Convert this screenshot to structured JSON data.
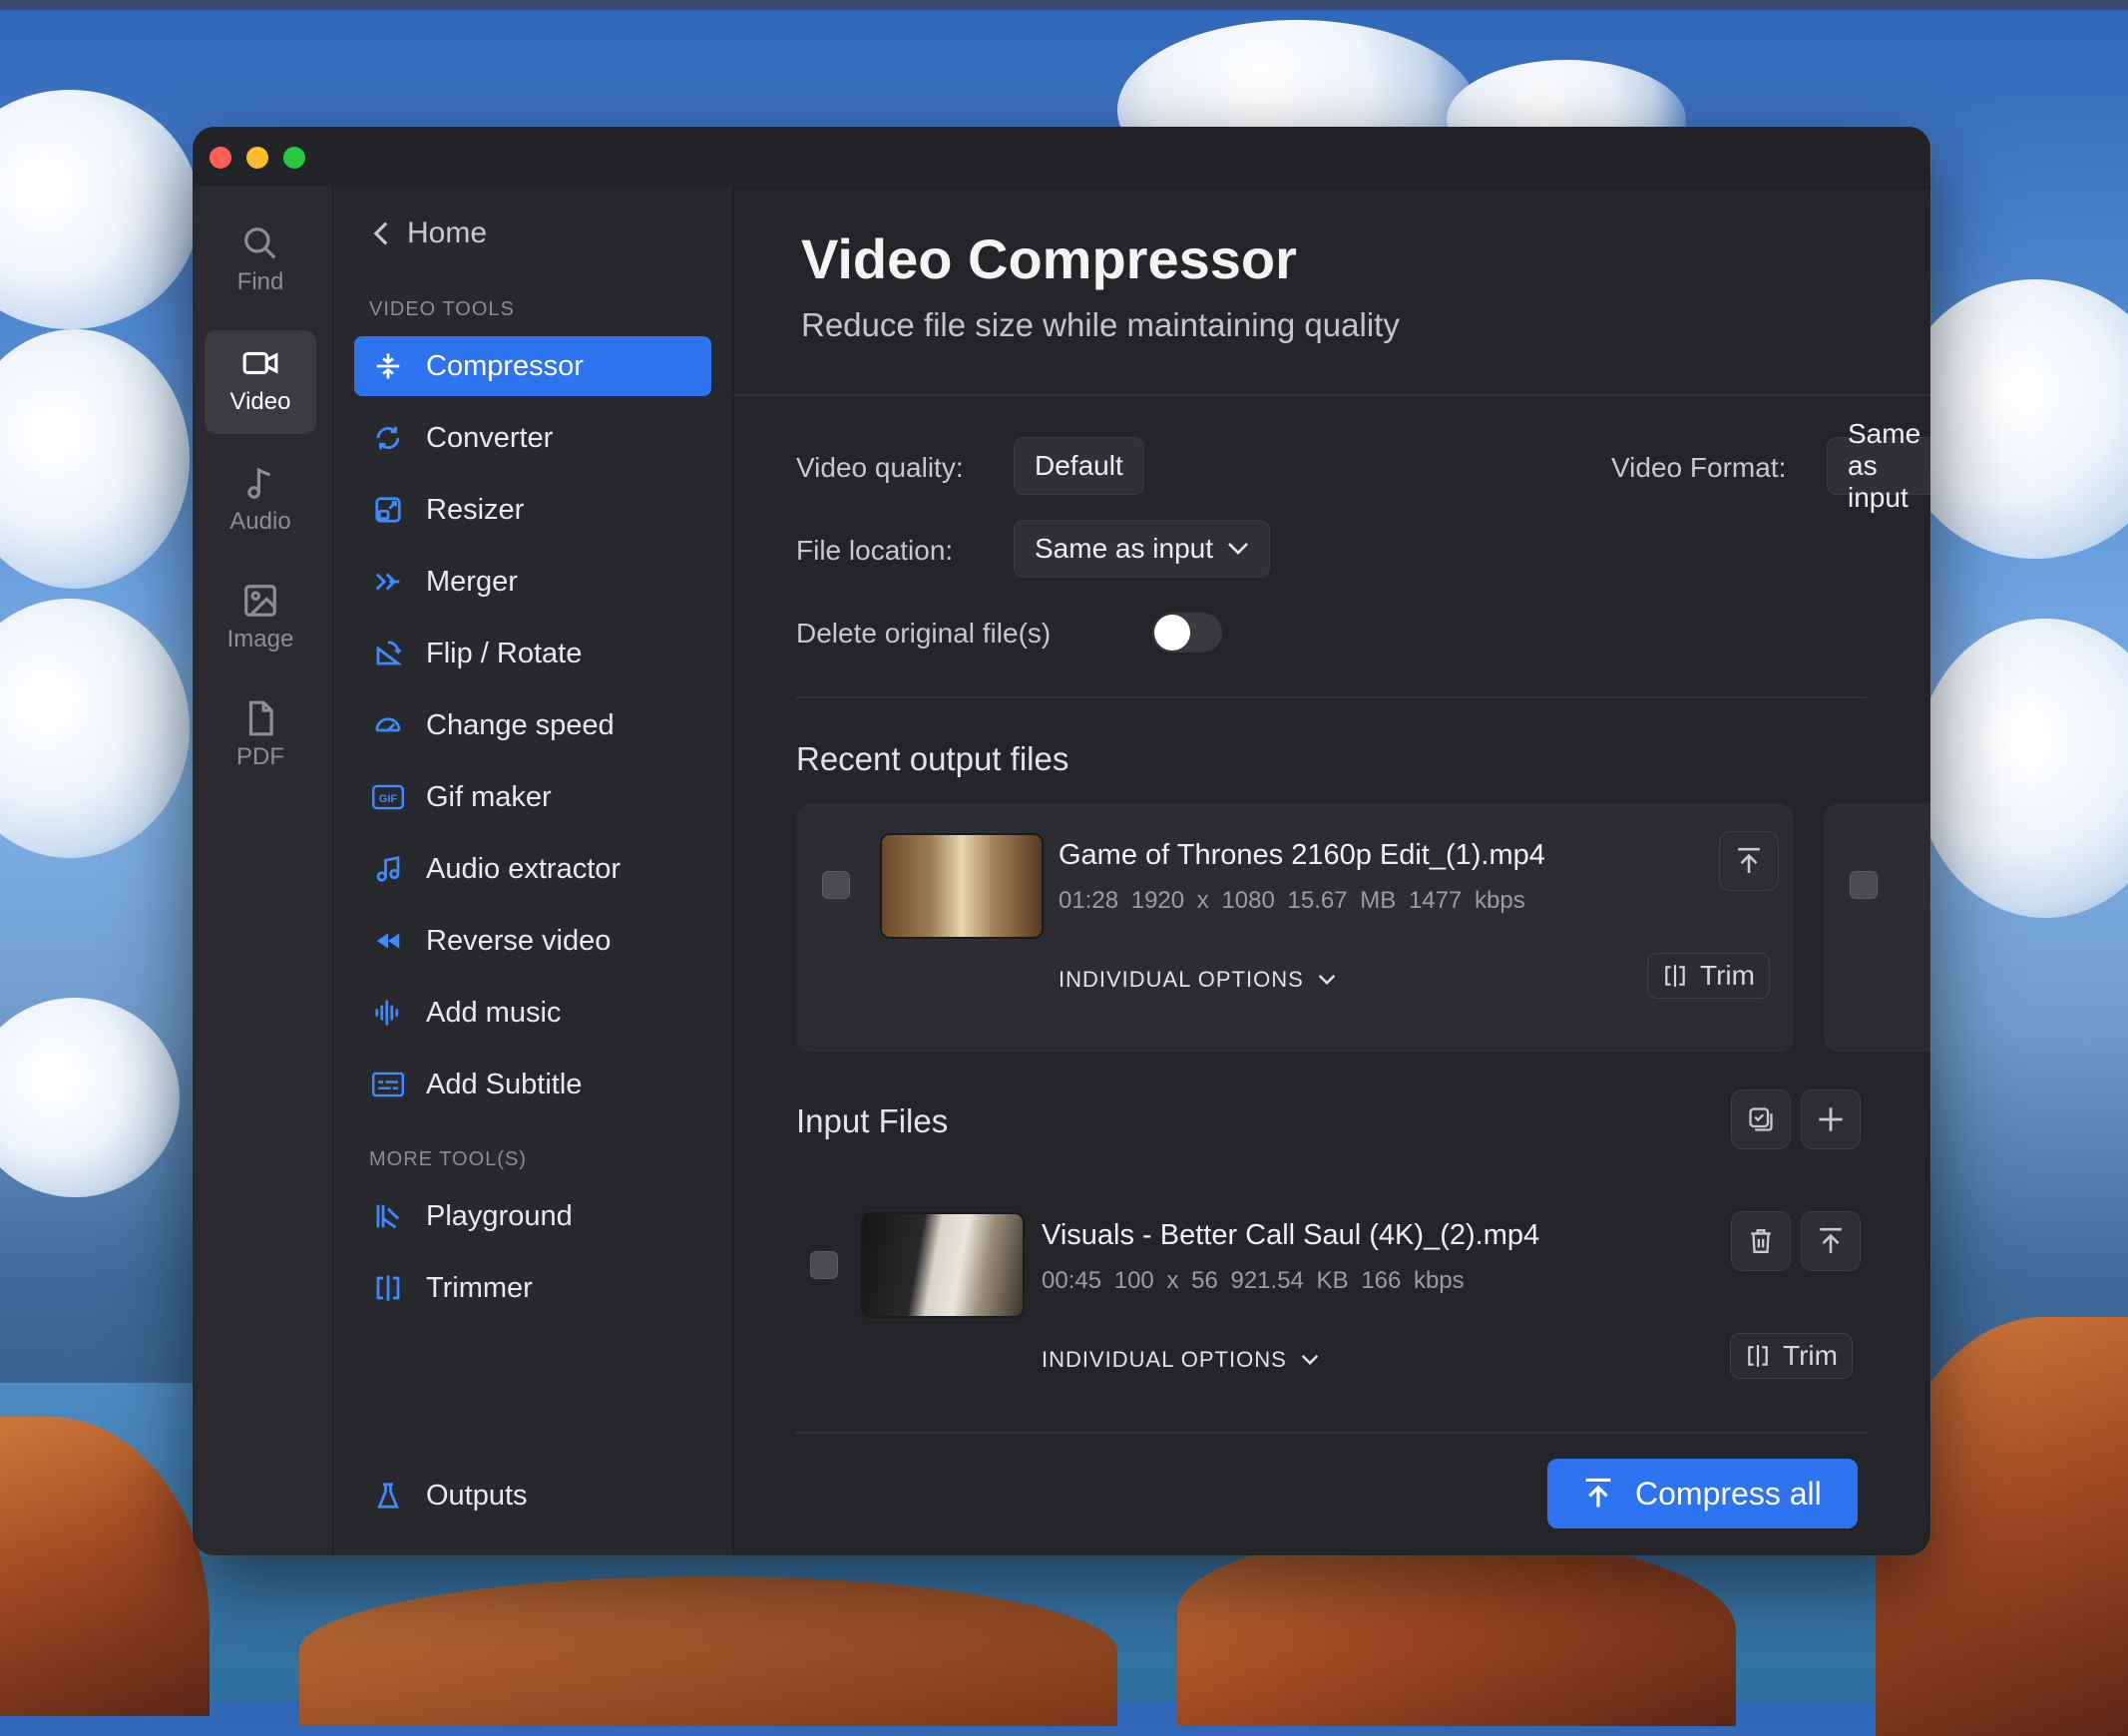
{
  "nav_rail": [
    {
      "label": "Find",
      "icon": "magnifier"
    },
    {
      "label": "Video",
      "icon": "video-camera",
      "active": true
    },
    {
      "label": "Audio",
      "icon": "music-note"
    },
    {
      "label": "Image",
      "icon": "image"
    },
    {
      "label": "PDF",
      "icon": "document"
    }
  ],
  "sidebar": {
    "back_label": "Home",
    "video_tools_heading": "VIDEO TOOLS",
    "tools": [
      {
        "label": "Compressor",
        "icon": "compress",
        "active": true
      },
      {
        "label": "Converter",
        "icon": "refresh"
      },
      {
        "label": "Resizer",
        "icon": "resize"
      },
      {
        "label": "Merger",
        "icon": "merge-arrows"
      },
      {
        "label": "Flip / Rotate",
        "icon": "rotate"
      },
      {
        "label": "Change speed",
        "icon": "speedometer"
      },
      {
        "label": "Gif maker",
        "icon": "gif"
      },
      {
        "label": "Audio extractor",
        "icon": "music-note"
      },
      {
        "label": "Reverse video",
        "icon": "rewind"
      },
      {
        "label": "Add music",
        "icon": "waveform"
      },
      {
        "label": "Add Subtitle",
        "icon": "subtitles"
      }
    ],
    "more_tools_heading": "MORE TOOL(S)",
    "more_tools": [
      {
        "label": "Playground",
        "icon": "playground"
      },
      {
        "label": "Trimmer",
        "icon": "trim"
      }
    ],
    "outputs_label": "Outputs"
  },
  "main": {
    "title": "Video Compressor",
    "subtitle": "Reduce file size while maintaining quality",
    "video_quality_label": "Video quality:",
    "video_quality_value": "Default",
    "video_format_label": "Video Format:",
    "video_format_value": "Same as input",
    "file_location_label": "File location:",
    "file_location_value": "Same as input",
    "delete_original_label": "Delete original file(s)",
    "delete_original_on": false,
    "recent_heading": "Recent output files",
    "recent_files": [
      {
        "name": "Game of Thrones 2160p Edit_(1).mp4",
        "duration": "01:28",
        "resolution": "1920 x 1080",
        "size": "15.67 MB",
        "bitrate": "1477 kbps",
        "options_label": "INDIVIDUAL OPTIONS",
        "trim_label": "Trim"
      }
    ],
    "input_heading": "Input Files",
    "input_files": [
      {
        "name": "Visuals - Better Call Saul (4K)_(2).mp4",
        "duration": "00:45",
        "resolution": "100 x 56",
        "size": "921.54 KB",
        "bitrate": "166 kbps",
        "options_label": "INDIVIDUAL OPTIONS",
        "trim_label": "Trim"
      }
    ],
    "compress_all_label": "Compress all"
  },
  "colors": {
    "accent": "#2e74f0",
    "window_bg": "#242528",
    "sidebar_bg": "#28292c",
    "icon_blue": "#3d8bff"
  }
}
